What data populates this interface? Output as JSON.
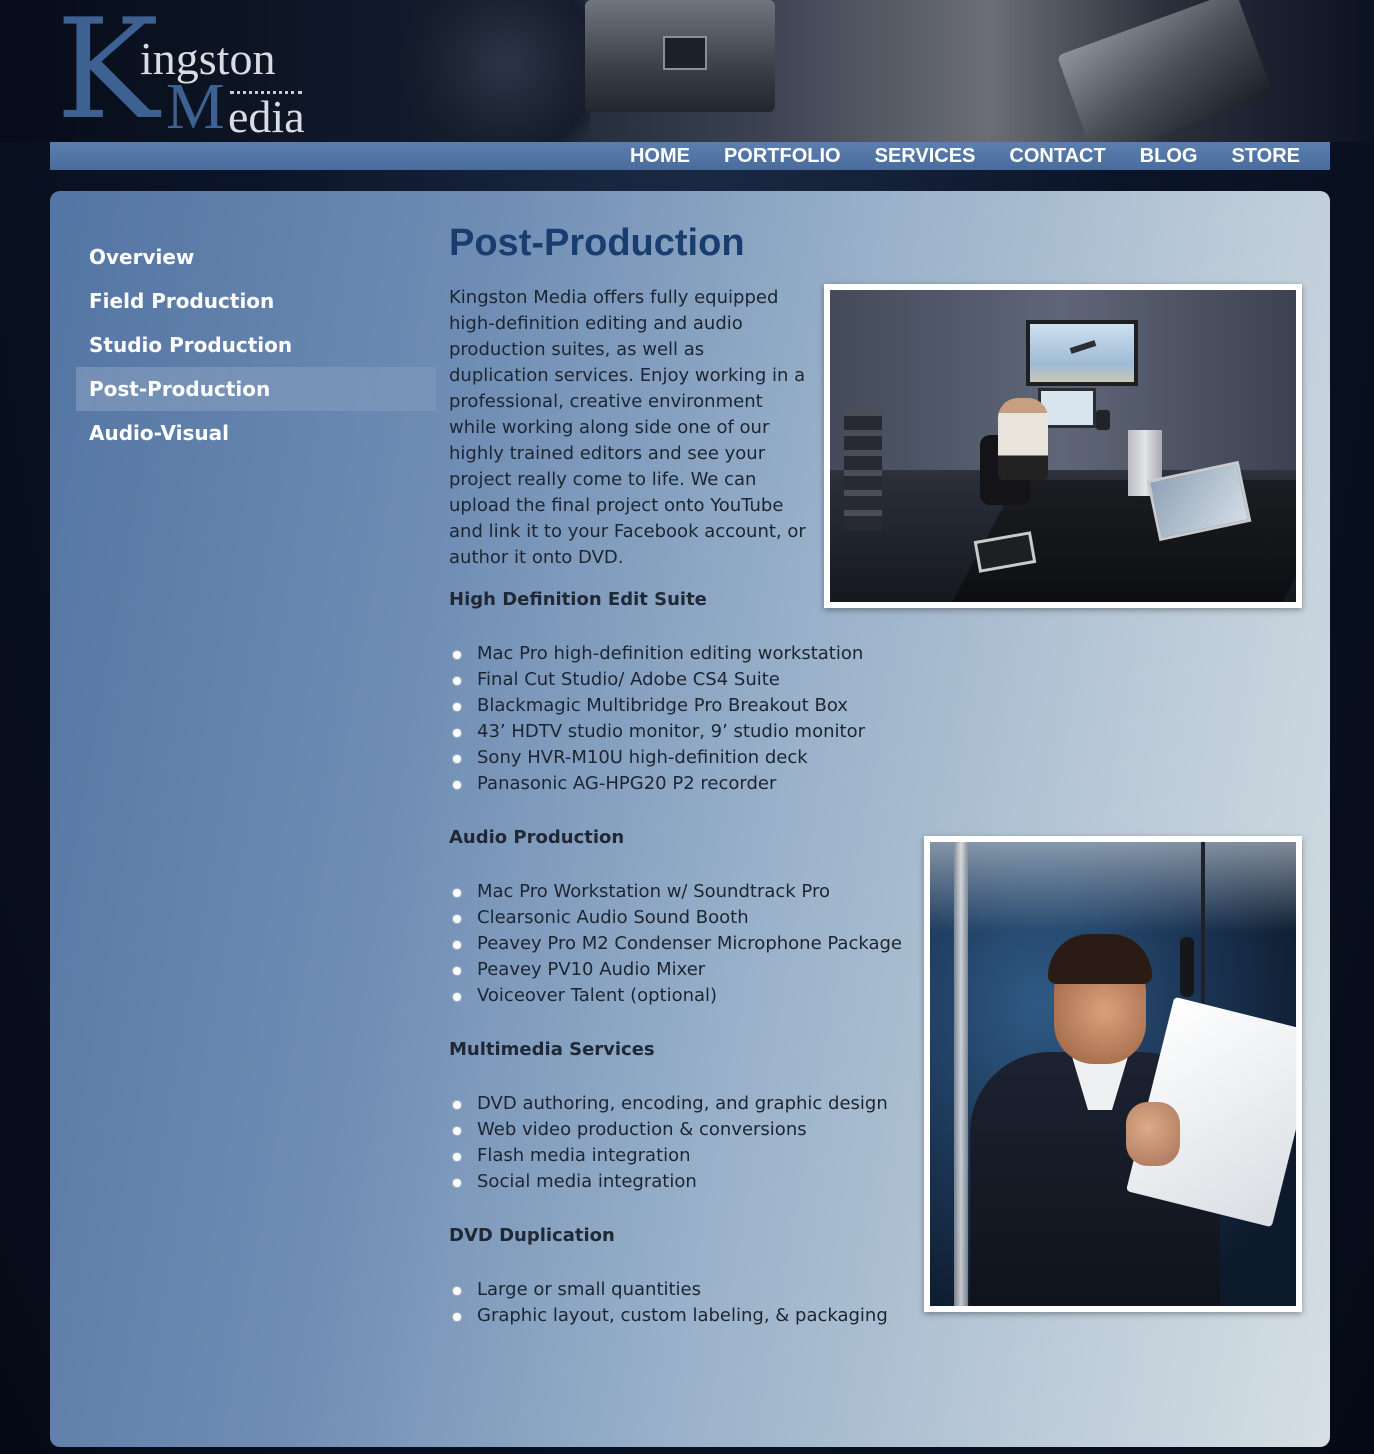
{
  "brand": {
    "logo_k": "K",
    "logo_line1": "ingston",
    "logo_m": "M",
    "logo_line2": "edia"
  },
  "nav": {
    "items": [
      {
        "label": "HOME"
      },
      {
        "label": "PORTFOLIO"
      },
      {
        "label": "SERVICES"
      },
      {
        "label": "CONTACT"
      },
      {
        "label": "BLOG"
      },
      {
        "label": "STORE"
      }
    ]
  },
  "sidebar": {
    "items": [
      {
        "label": "Overview",
        "active": false
      },
      {
        "label": "Field Production",
        "active": false
      },
      {
        "label": "Studio Production",
        "active": false
      },
      {
        "label": "Post-Production",
        "active": true
      },
      {
        "label": "Audio-Visual",
        "active": false
      }
    ]
  },
  "main": {
    "title": "Post-Production",
    "intro": "Kingston Media offers fully equipped high-definition editing and audio production suites, as well as duplication services.  Enjoy working in a professional, creative environment while working along side one of our highly trained editors and see your project really come to life.  We can upload the final project onto YouTube and link it to your Facebook account, or author it onto DVD.",
    "sections": [
      {
        "title": "High Definition Edit Suite",
        "items": [
          "Mac Pro high-definition editing workstation",
          "Final Cut Studio/ Adobe CS4 Suite",
          "Blackmagic Multibridge Pro Breakout Box",
          "43’ HDTV studio monitor, 9’ studio monitor",
          "Sony HVR-M10U high-definition deck",
          "Panasonic AG-HPG20 P2 recorder"
        ]
      },
      {
        "title": "Audio Production",
        "items": [
          "Mac Pro Workstation w/ Soundtrack Pro",
          "Clearsonic Audio Sound Booth",
          "Peavey Pro M2 Condenser Microphone Package",
          "Peavey PV10 Audio Mixer",
          "Voiceover Talent (optional)"
        ]
      },
      {
        "title": "Multimedia Services",
        "items": [
          "DVD authoring, encoding, and graphic design",
          "Web video production & conversions",
          "Flash media integration",
          "Social media integration"
        ]
      },
      {
        "title": "DVD Duplication",
        "items": [
          "Large or small quantities",
          "Graphic layout, custom labeling, & packaging"
        ]
      }
    ]
  },
  "colors": {
    "page_bg": "#0c1528",
    "nav_bar": "#4a6c9c",
    "title": "#1a3d70",
    "logo_blue": "#3d6292"
  }
}
